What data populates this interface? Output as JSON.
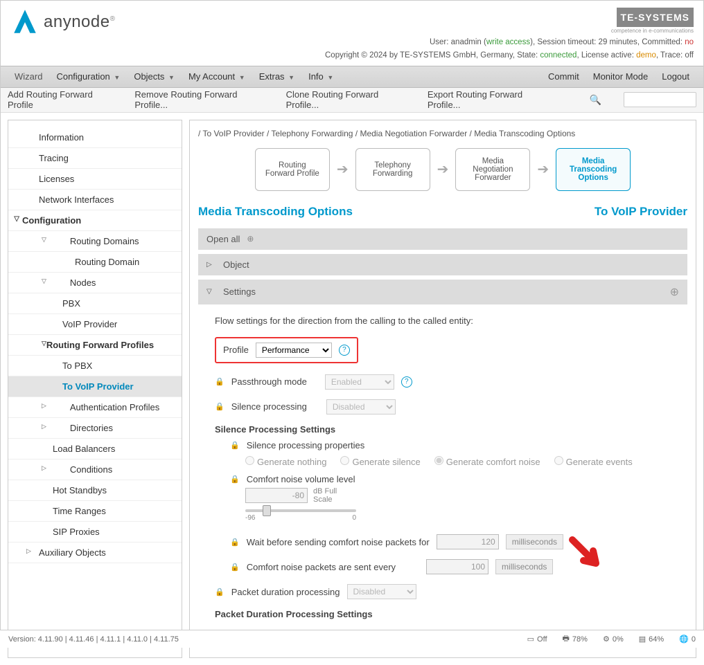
{
  "brand": {
    "name": "anynode"
  },
  "header": {
    "user_prefix": "User: ",
    "user": "anadmin",
    "access": "write access",
    "session_prefix": ", Session timeout: ",
    "session": "29 minutes",
    "committed_prefix": ", Committed: ",
    "committed": "no",
    "copyright": "Copyright © 2024 by TE-SYSTEMS GmbH, Germany, State: ",
    "state": "connected",
    "license_prefix": ", License active: ",
    "license": "demo",
    "trace_prefix": ", Trace: ",
    "trace": "off",
    "te_logo": "TE-SYSTEMS",
    "te_sub": "competence in e-communications"
  },
  "menu": {
    "wizard": "Wizard",
    "configuration": "Configuration",
    "objects": "Objects",
    "my_account": "My Account",
    "extras": "Extras",
    "info": "Info",
    "commit": "Commit",
    "monitor": "Monitor Mode",
    "logout": "Logout"
  },
  "toolbar": {
    "add": "Add Routing Forward Profile",
    "remove": "Remove Routing Forward Profile...",
    "clone": "Clone Routing Forward Profile...",
    "export": "Export Routing Forward Profile..."
  },
  "sidebar": {
    "information": "Information",
    "tracing": "Tracing",
    "licenses": "Licenses",
    "network": "Network Interfaces",
    "configuration": "Configuration",
    "routing_domains": "Routing Domains",
    "routing_domain": "Routing Domain",
    "nodes": "Nodes",
    "pbx": "PBX",
    "voip_provider": "VoIP Provider",
    "rfp": "Routing Forward Profiles",
    "to_pbx": "To PBX",
    "to_voip": "To VoIP Provider",
    "auth": "Authentication Profiles",
    "directories": "Directories",
    "load_balancers": "Load Balancers",
    "conditions": "Conditions",
    "hot_standbys": "Hot Standbys",
    "time_ranges": "Time Ranges",
    "sip_proxies": "SIP Proxies",
    "aux": "Auxiliary Objects"
  },
  "main": {
    "breadcrumb": "/ To VoIP Provider / Telephony Forwarding / Media Negotiation Forwarder / Media Transcoding Options",
    "flow": {
      "b1": "Routing Forward Profile",
      "b2": "Telephony Forwarding",
      "b3": "Media Negotiation Forwarder",
      "b4": "Media Transcoding Options"
    },
    "title_left": "Media Transcoding Options",
    "title_right": "To VoIP Provider",
    "open_all": "Open all",
    "object": "Object",
    "settings": "Settings",
    "flow_desc": "Flow settings for the direction from the calling to the called entity:",
    "profile_label": "Profile",
    "profile_value": "Performance",
    "passthrough_label": "Passthrough mode",
    "passthrough_value": "Enabled",
    "silence_label": "Silence processing",
    "silence_value": "Disabled",
    "silence_heading": "Silence Processing Settings",
    "silence_props": "Silence processing properties",
    "radio": {
      "nothing": "Generate nothing",
      "silence": "Generate silence",
      "comfort": "Generate comfort noise",
      "events": "Generate events"
    },
    "cn_volume_label": "Comfort noise volume level",
    "cn_volume_value": "-80",
    "cn_volume_unit": "dB Full Scale",
    "slider_min": "-96",
    "slider_max": "0",
    "wait_label": "Wait before sending comfort noise packets for",
    "wait_value": "120",
    "wait_unit": "milliseconds",
    "sent_label": "Comfort noise packets are sent every",
    "sent_value": "100",
    "sent_unit": "milliseconds",
    "packet_dur_label": "Packet duration processing",
    "packet_dur_value": "Disabled",
    "packet_dur_heading": "Packet Duration Processing Settings"
  },
  "footer": {
    "version": "Version:  4.11.90  |  4.11.46  |  4.11.1  |  4.11.0  |  4.11.75",
    "off": "Off",
    "print": "78%",
    "cpu": "0%",
    "mem": "64%",
    "last": "0"
  }
}
